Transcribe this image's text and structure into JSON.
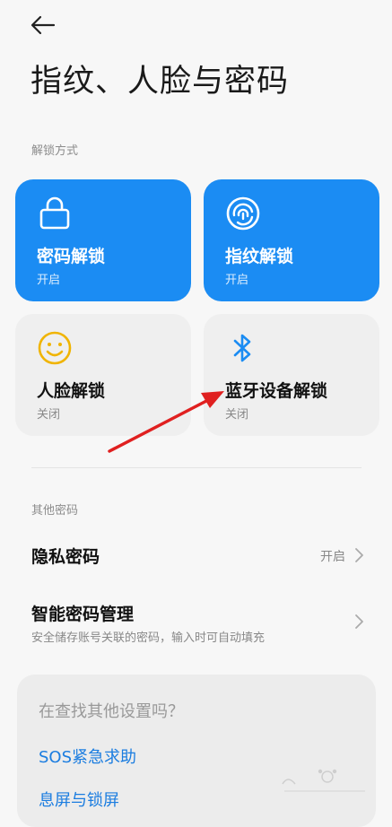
{
  "header": {
    "title": "指纹、人脸与密码"
  },
  "sections": {
    "unlock_methods": "解锁方式",
    "other_passwords": "其他密码"
  },
  "unlock_cards": [
    {
      "name": "密码解锁",
      "state": "开启",
      "icon": "lock-icon",
      "active": true
    },
    {
      "name": "指纹解锁",
      "state": "开启",
      "icon": "fingerprint-icon",
      "active": true
    },
    {
      "name": "人脸解锁",
      "state": "关闭",
      "icon": "smiley-face-icon",
      "active": false
    },
    {
      "name": "蓝牙设备解锁",
      "state": "关闭",
      "icon": "bluetooth-icon",
      "active": false
    }
  ],
  "other": {
    "privacy_password": {
      "label": "隐私密码",
      "value": "开启"
    },
    "smart_password": {
      "label": "智能密码管理",
      "sub": "安全储存账号关联的密码，输入时可自动填充"
    }
  },
  "search_suggest": {
    "question": "在查找其他设置吗？",
    "links": [
      "SOS紧急求助",
      "息屏与锁屏"
    ]
  },
  "colors": {
    "accent": "#1b8cf3",
    "annotation_arrow": "#e02020",
    "face_icon": "#f0b400"
  }
}
